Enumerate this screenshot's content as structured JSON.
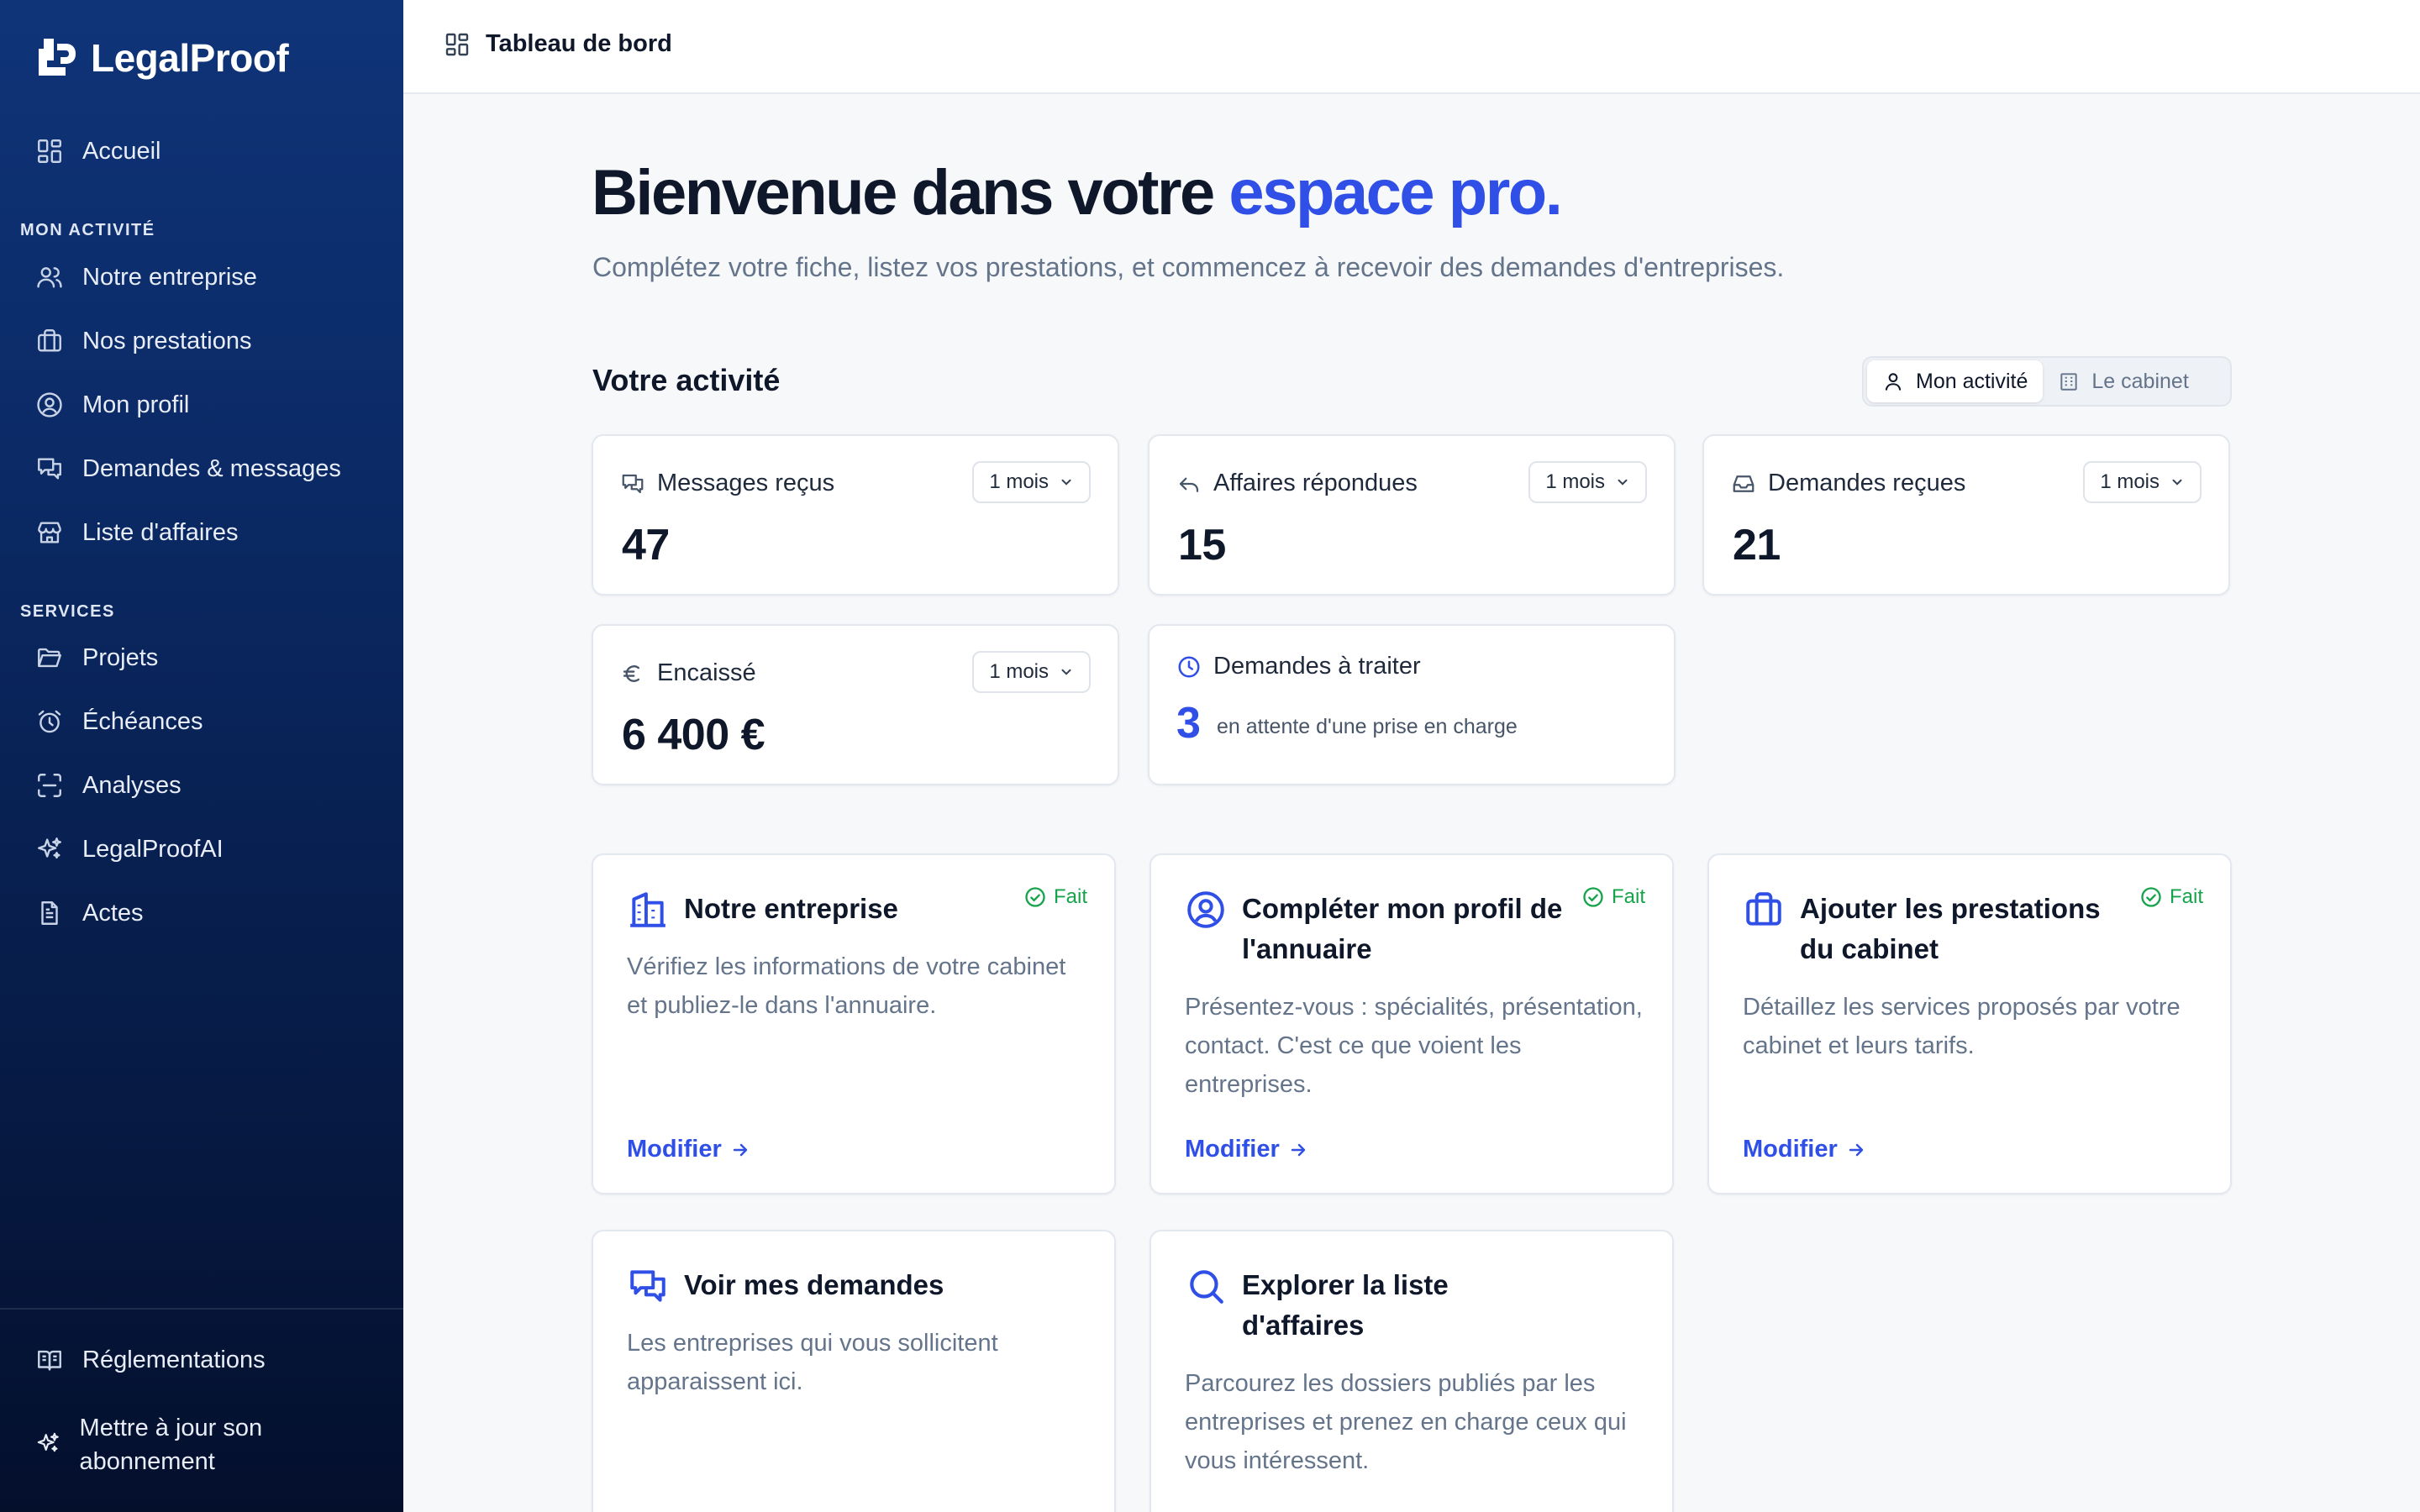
{
  "brand": {
    "name": "LegalProof"
  },
  "colors": {
    "accent": "#2f4fe6",
    "success": "#16a34a",
    "sidebar_top": "#0f3478",
    "sidebar_bottom": "#040f2c"
  },
  "sidebar": {
    "home": {
      "label": "Accueil",
      "icon": "grid-icon"
    },
    "activity_label": "MON ACTIVITÉ",
    "activity_items": [
      {
        "label": "Notre entreprise",
        "icon": "users-icon"
      },
      {
        "label": "Nos prestations",
        "icon": "briefcase-icon"
      },
      {
        "label": "Mon profil",
        "icon": "user-circle-icon"
      },
      {
        "label": "Demandes & messages",
        "icon": "messages-icon"
      },
      {
        "label": "Liste d'affaires",
        "icon": "store-icon"
      }
    ],
    "services_label": "SERVICES",
    "services_items": [
      {
        "label": "Projets",
        "icon": "folder-icon"
      },
      {
        "label": "Échéances",
        "icon": "alarm-clock-icon"
      },
      {
        "label": "Analyses",
        "icon": "scan-icon"
      },
      {
        "label": "LegalProofAI",
        "icon": "sparkles-icon"
      },
      {
        "label": "Actes",
        "icon": "document-icon"
      }
    ],
    "regulations": {
      "label": "Réglementations",
      "icon": "book-icon"
    },
    "upgrade": {
      "label": "Mettre à jour son abonnement",
      "icon": "sparkles-icon"
    }
  },
  "topbar": {
    "breadcrumb": "Tableau de bord"
  },
  "hero": {
    "title_start": "Bienvenue dans votre ",
    "title_accent": "espace pro.",
    "subtitle": "Complétez votre fiche, listez vos prestations, et commencez à recevoir des demandes d'entreprises."
  },
  "activity": {
    "title": "Votre activité",
    "toggle": {
      "mine": "Mon activité",
      "firm": "Le cabinet",
      "selected": "Mon activité"
    },
    "stats": [
      {
        "label": "Messages reçus",
        "value": "47",
        "period": "1 mois"
      },
      {
        "label": "Affaires répondues",
        "value": "15",
        "period": "1 mois"
      },
      {
        "label": "Demandes reçues",
        "value": "21",
        "period": "1 mois"
      },
      {
        "label": "Encaissé",
        "value": "6 400 €",
        "period": "1 mois"
      }
    ],
    "pending": {
      "label": "Demandes à traiter",
      "count": "3",
      "text": "en attente d'une prise en charge"
    }
  },
  "tasks": [
    {
      "title": "Notre entreprise",
      "status": "Fait",
      "description": "Vérifiez les informations de votre cabinet et publiez-le dans l'annuaire.",
      "link": "Modifier"
    },
    {
      "title": "Compléter mon profil de l'annuaire",
      "status": "Fait",
      "description": "Présentez-vous : spécialités, présentation, contact. C'est ce que voient les entreprises.",
      "link": "Modifier"
    },
    {
      "title": "Ajouter les prestations du cabinet",
      "status": "Fait",
      "description": "Détaillez les services proposés par votre cabinet et leurs tarifs.",
      "link": "Modifier"
    },
    {
      "title": "Voir mes demandes",
      "description": "Les entreprises qui vous sollicitent apparaissent ici."
    },
    {
      "title": "Explorer la liste d'affaires",
      "description": "Parcourez les dossiers publiés par les entreprises et prenez en charge ceux qui vous intéressent."
    }
  ]
}
